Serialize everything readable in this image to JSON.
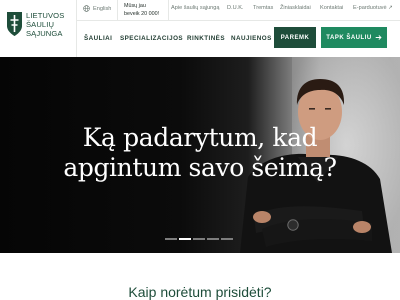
{
  "brand": {
    "lines": [
      "LIETUVOS",
      "ŠAULIŲ",
      "SĄJUNGA"
    ]
  },
  "topbar": {
    "language": "English",
    "members_line1": "Mūsų jau",
    "members_line2": "beveik 20 000!",
    "links": [
      "Apie šaulių sąjungą",
      "D.U.K.",
      "Tremtas",
      "Žiniasklaidai",
      "Kontaktai",
      "E-parduotuvė ↗"
    ]
  },
  "nav": {
    "items": [
      "ŠAULIAI",
      "SPECIALIZACIJOS",
      "RINKTINĖS",
      "NAUJIENOS"
    ],
    "support_label": "PAREMK",
    "join_label": "TAPK ŠAULIU",
    "join_icon": "arrow-right-icon"
  },
  "hero": {
    "line1": "Ką padarytum, kad",
    "line2": "apgintum savo šeimą?",
    "slides": 5,
    "active_slide": 2
  },
  "section": {
    "title": "Kaip norėtum prisidėti?"
  },
  "colors": {
    "brand_green": "#1e4d3a",
    "accent_green": "#1f8a60"
  }
}
